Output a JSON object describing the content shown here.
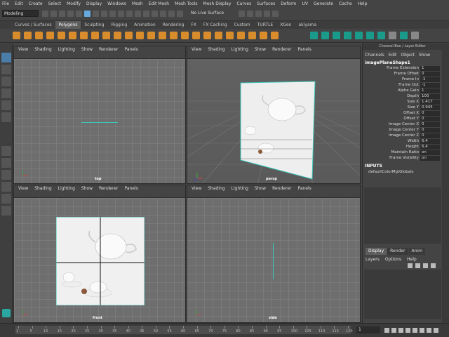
{
  "menubar": [
    "File",
    "Edit",
    "Create",
    "Select",
    "Modify",
    "Display",
    "Windows",
    "Mesh",
    "Edit Mesh",
    "Mesh Tools",
    "Mesh Display",
    "Curves",
    "Surfaces",
    "Deform",
    "UV",
    "Generate",
    "Cache",
    "Help"
  ],
  "status": {
    "mode": "Modeling",
    "live_surface": "No Live Surface"
  },
  "shelf": {
    "tabs": [
      "Curves / Surfaces",
      "Polygons",
      "Sculpting",
      "Rigging",
      "Animation",
      "Rendering",
      "FX",
      "FX Caching",
      "Custom",
      "TURTLE",
      "XGen",
      "akiyama"
    ],
    "active": "Polygons"
  },
  "viewport_menu": [
    "View",
    "Shading",
    "Lighting",
    "Show",
    "Renderer",
    "Panels"
  ],
  "viewports": {
    "top": "top",
    "persp": "persp",
    "front": "front",
    "side": "side"
  },
  "channel_box": {
    "header": "Channel Box / Layer Editor",
    "menu": [
      "Channels",
      "Edit",
      "Object",
      "Show"
    ],
    "object": "imagePlaneShape1",
    "attributes": [
      {
        "name": "Frame Extension",
        "value": "1"
      },
      {
        "name": "Frame Offset",
        "value": "0"
      },
      {
        "name": "Frame In",
        "value": "-1"
      },
      {
        "name": "Frame Out",
        "value": "-1"
      },
      {
        "name": "Alpha Gain",
        "value": "1"
      },
      {
        "name": "Depth",
        "value": "100"
      },
      {
        "name": "Size X",
        "value": "1.417"
      },
      {
        "name": "Size Y",
        "value": "0.945"
      },
      {
        "name": "Offset X",
        "value": "0"
      },
      {
        "name": "Offset Y",
        "value": "0"
      },
      {
        "name": "Image Center X",
        "value": "0"
      },
      {
        "name": "Image Center Y",
        "value": "0"
      },
      {
        "name": "Image Center Z",
        "value": "0"
      },
      {
        "name": "Width",
        "value": "6.4"
      },
      {
        "name": "Height",
        "value": "6.4"
      },
      {
        "name": "Maintain Ratio",
        "value": "on"
      },
      {
        "name": "Frame Visibility",
        "value": "on"
      }
    ],
    "inputs_label": "INPUTS",
    "input_node": "defaultColorMgtGlobals"
  },
  "layer_editor": {
    "tabs": [
      "Display",
      "Render",
      "Anim"
    ],
    "active": "Display",
    "menu": [
      "Layers",
      "Options",
      "Help"
    ]
  },
  "timeline": {
    "ticks": [
      "1",
      "5",
      "10",
      "15",
      "20",
      "25",
      "30",
      "35",
      "40",
      "45",
      "50",
      "55",
      "60",
      "65",
      "70",
      "75",
      "80",
      "85",
      "90",
      "95",
      "100",
      "105",
      "110",
      "115",
      "120"
    ],
    "current_frame": "1"
  },
  "colors": {
    "accent": "#2aa7a0",
    "shelf_orange": "#d98c2b",
    "selection_blue": "#4a7ea8"
  }
}
